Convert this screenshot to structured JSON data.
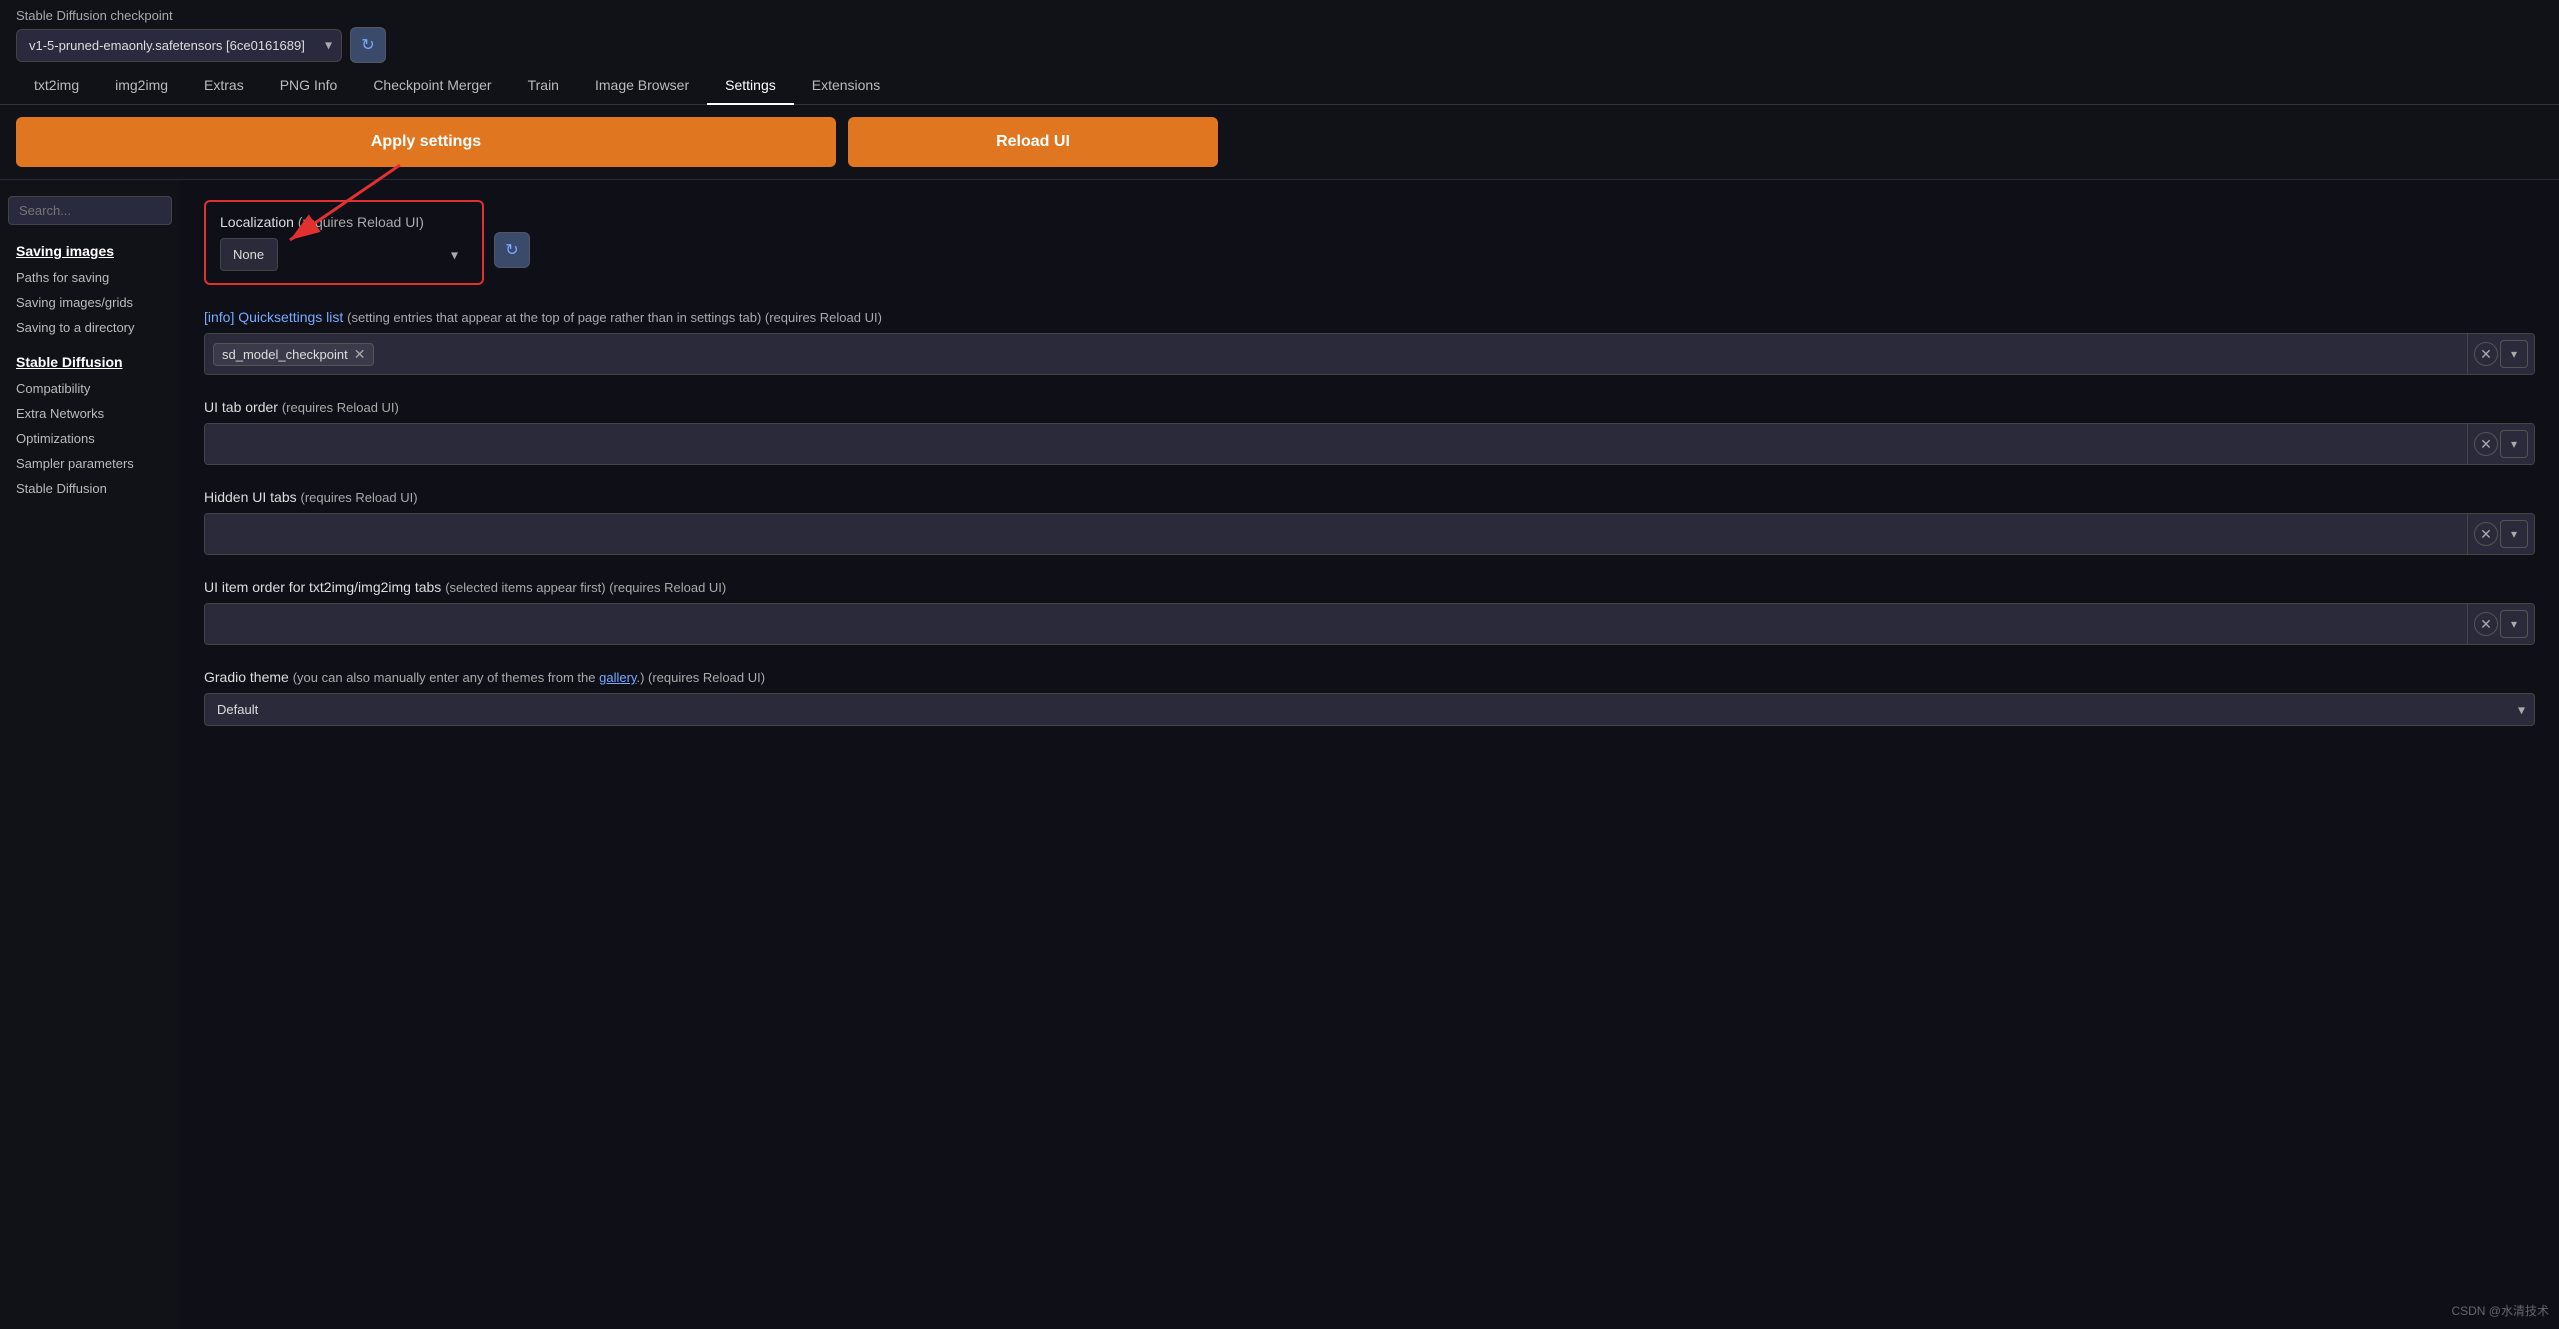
{
  "header": {
    "checkpoint_label": "Stable Diffusion checkpoint",
    "checkpoint_value": "v1-5-pruned-emaonly.safetensors [6ce0161689]",
    "refresh_icon": "↻"
  },
  "nav": {
    "tabs": [
      {
        "label": "txt2img",
        "active": false
      },
      {
        "label": "img2img",
        "active": false
      },
      {
        "label": "Extras",
        "active": false
      },
      {
        "label": "PNG Info",
        "active": false
      },
      {
        "label": "Checkpoint Merger",
        "active": false
      },
      {
        "label": "Train",
        "active": false
      },
      {
        "label": "Image Browser",
        "active": false
      },
      {
        "label": "Settings",
        "active": true
      },
      {
        "label": "Extensions",
        "active": false
      }
    ]
  },
  "actions": {
    "apply_label": "Apply settings",
    "reload_label": "Reload UI"
  },
  "sidebar": {
    "search_placeholder": "Search...",
    "sections": [
      {
        "title": "Saving images",
        "items": [
          "Paths for saving",
          "Saving images/grids",
          "Saving to a directory"
        ]
      },
      {
        "title": "Stable Diffusion",
        "items": [
          "Compatibility",
          "Extra Networks",
          "Optimizations",
          "Sampler parameters",
          "Stable Diffusion"
        ]
      }
    ]
  },
  "settings": {
    "localization": {
      "label": "Localization",
      "note": "(requires Reload UI)",
      "value": "None"
    },
    "quicksettings": {
      "label": "[info] Quicksettings list",
      "note": "(setting entries that appear at the top of page rather than in settings tab) (requires Reload UI)",
      "tags": [
        "sd_model_checkpoint"
      ]
    },
    "ui_tab_order": {
      "label": "UI tab order",
      "note": "(requires Reload UI)",
      "tags": []
    },
    "hidden_ui_tabs": {
      "label": "Hidden UI tabs",
      "note": "(requires Reload UI)",
      "tags": []
    },
    "ui_item_order": {
      "label": "UI item order for txt2img/img2img tabs",
      "note": "(selected items appear first) (requires Reload UI)",
      "tags": []
    },
    "gradio_theme": {
      "label": "Gradio theme",
      "note": "(you can also manually enter any of themes from the gallery.) (requires Reload UI)",
      "value": "Default"
    }
  },
  "watermark": "CSDN @水清技术"
}
